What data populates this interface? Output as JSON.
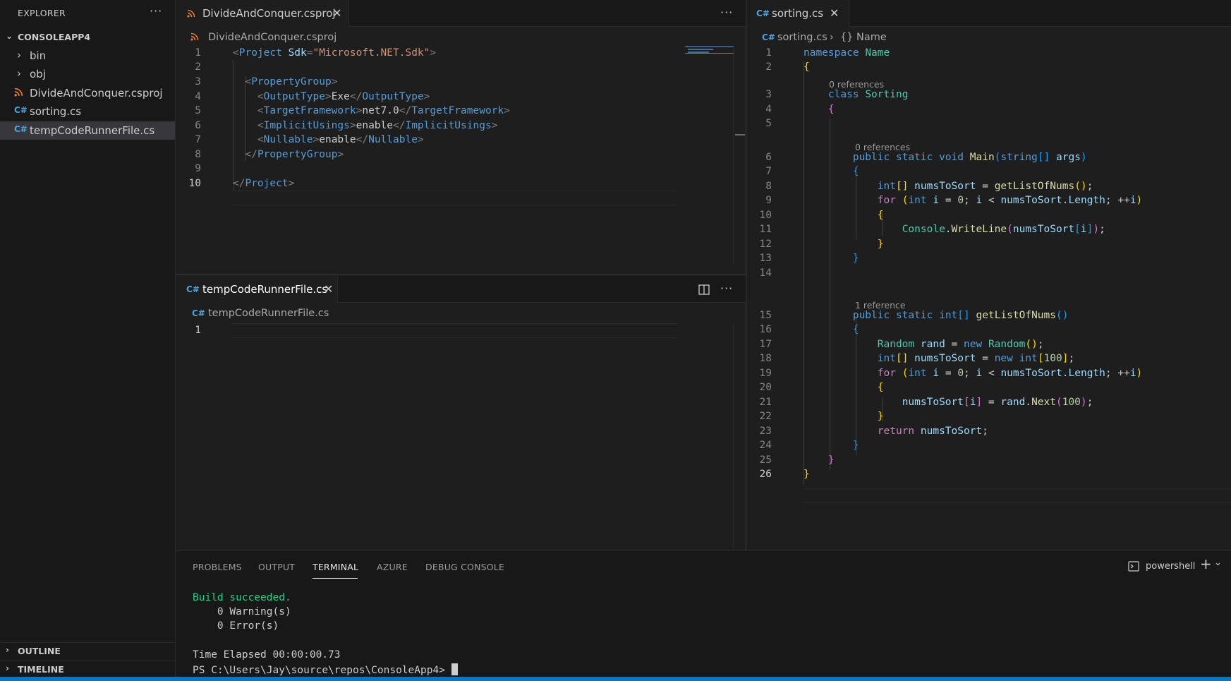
{
  "sidebar": {
    "title": "EXPLORER",
    "more": "···",
    "project": "CONSOLEAPP4",
    "items": [
      {
        "label": "bin",
        "type": "folder"
      },
      {
        "label": "obj",
        "type": "folder"
      },
      {
        "label": "DivideAndConquer.csproj",
        "type": "rss"
      },
      {
        "label": "sorting.cs",
        "type": "cs"
      },
      {
        "label": "tempCodeRunnerFile.cs",
        "type": "cs",
        "selected": true
      }
    ],
    "outline": "OUTLINE",
    "timeline": "TIMELINE"
  },
  "editor_left_top": {
    "tab": "DivideAndConquer.csproj",
    "breadcrumb": "DivideAndConquer.csproj",
    "more": "···",
    "line_numbers": [
      "1",
      "2",
      "3",
      "4",
      "5",
      "6",
      "7",
      "8",
      "9",
      "10"
    ]
  },
  "editor_left_bottom": {
    "tab": "tempCodeRunnerFile.cs",
    "breadcrumb": "tempCodeRunnerFile.cs",
    "more": "···",
    "line_numbers": [
      "1"
    ]
  },
  "editor_right": {
    "tab": "sorting.cs",
    "breadcrumb_file": "sorting.cs",
    "breadcrumb_sep": "›",
    "breadcrumb_symbol": "{} Name",
    "line_numbers": [
      "1",
      "2",
      "3",
      "4",
      "5",
      "6",
      "7",
      "8",
      "9",
      "10",
      "11",
      "12",
      "13",
      "14",
      "15",
      "16",
      "17",
      "18",
      "19",
      "20",
      "21",
      "22",
      "23",
      "24",
      "25",
      "26"
    ],
    "lens_0": "0 references",
    "lens_1": "0 references",
    "lens_2": "1 reference"
  },
  "panel": {
    "tabs": [
      "PROBLEMS",
      "OUTPUT",
      "TERMINAL",
      "AZURE",
      "DEBUG CONSOLE"
    ],
    "active_tab": "TERMINAL",
    "shell": "powershell",
    "terminal": {
      "build": "Build succeeded.",
      "warnings": "    0 Warning(s)",
      "errors": "    0 Error(s)",
      "elapsed": "Time Elapsed 00:00:00.73",
      "prompt": "PS C:\\Users\\Jay\\source\\repos\\ConsoleApp4> "
    }
  },
  "colors": {
    "accent": "#007acc",
    "success": "#23d18b",
    "cs_icon": "#4aa3df",
    "rss_icon": "#e37933"
  }
}
